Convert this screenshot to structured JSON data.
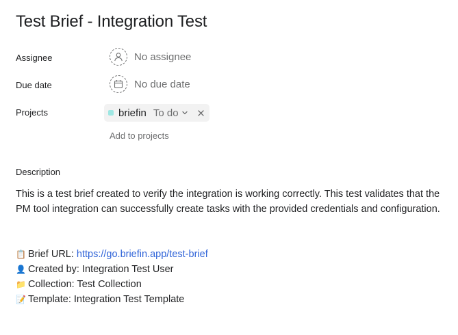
{
  "task": {
    "title": "Test Brief - Integration Test"
  },
  "fields": {
    "assignee": {
      "label": "Assignee",
      "value": "No assignee"
    },
    "due_date": {
      "label": "Due date",
      "value": "No due date"
    },
    "projects": {
      "label": "Projects",
      "project_name": "briefin",
      "section": "To do",
      "project_color": "#9ee7e3",
      "add_label": "Add to projects"
    }
  },
  "description": {
    "label": "Description",
    "paragraph": "This is a test brief created to verify the integration is working correctly. This test validates that the PM tool integration can successfully create tasks with the provided credentials and configuration.",
    "meta": [
      {
        "emoji": "📋",
        "label": "Brief URL: ",
        "link": "https://go.briefin.app/test-brief"
      },
      {
        "emoji": "👤",
        "label": "Created by: Integration Test User"
      },
      {
        "emoji": "📁",
        "label": "Collection: Test Collection"
      },
      {
        "emoji": "📝",
        "label": "Template: Integration Test Template"
      }
    ]
  },
  "colors": {
    "text_primary": "#1e1f21",
    "text_secondary": "#6d6e6f",
    "link": "#2f63d8",
    "chip_background": "#f2f2f2"
  }
}
